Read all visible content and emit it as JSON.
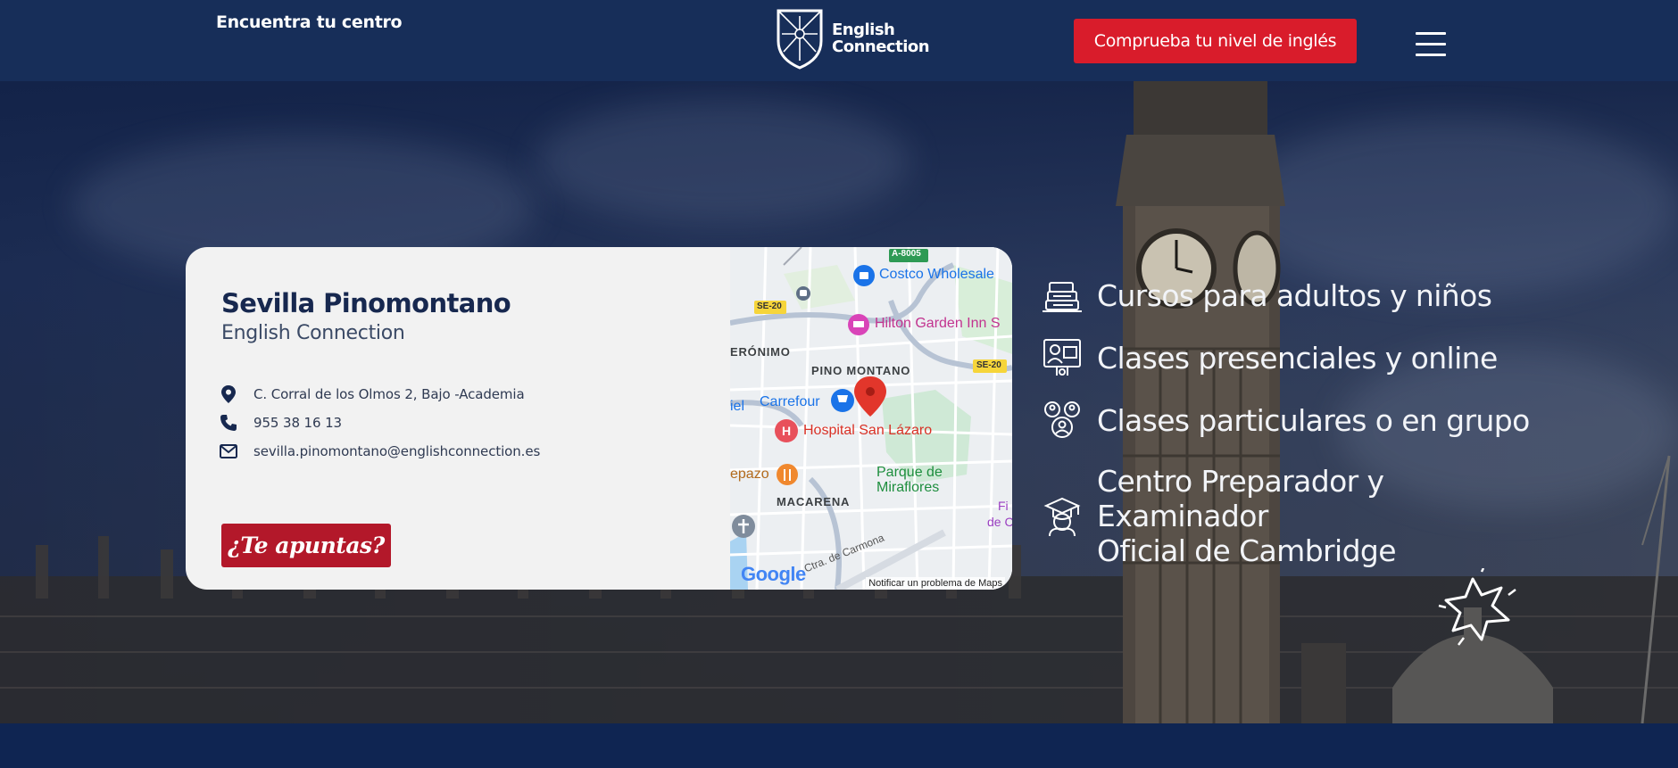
{
  "header": {
    "find_center": "Encuentra tu centro",
    "logo_line1": "English",
    "logo_line2": "Connection",
    "level_button": "Comprueba tu nivel de inglés"
  },
  "card": {
    "title": "Sevilla Pinomontano",
    "subtitle": "English Connection",
    "address": "C. Corral de los Olmos 2, Bajo -Academia",
    "phone": "955 38 16 13",
    "email": "sevilla.pinomontano@englishconnection.es",
    "join_button": "¿Te apuntas?"
  },
  "map": {
    "labels": {
      "a8005": "A-8005",
      "costco": "Costco Wholesale",
      "se20_left": "SE-20",
      "hilton": "Hilton Garden Inn S",
      "geronimo": "ERÓNIMO",
      "pino_montano": "PINO MONTANO",
      "se20_right": "SE-20",
      "carrefour": "Carrefour",
      "iel": "iel",
      "hospital": "Hospital San Lázaro",
      "parque1": "Parque de",
      "parque2": "Miraflores",
      "epazo": "epazo",
      "macarena": "MACARENA",
      "fi": "Fi",
      "dec": "de C",
      "carmona": "Ctra. de Carmona",
      "google": "Google",
      "report": "Notificar un problema de Maps"
    }
  },
  "features": [
    {
      "text": "Cursos para adultos y niños",
      "icon": "books-icon"
    },
    {
      "text": "Clases presenciales y online",
      "icon": "online-class-icon"
    },
    {
      "text": "Clases particulares o en grupo",
      "icon": "group-icon"
    },
    {
      "line1": "Centro Preparador y",
      "line2": "Examinador",
      "line3": "Oficial de Cambridge",
      "icon": "graduate-icon"
    }
  ],
  "colors": {
    "header_bg": "#172e59",
    "accent_red": "#d91c2b",
    "button_red": "#b3182a",
    "navy_text": "#17284f",
    "bottom_band": "#0f2552"
  }
}
